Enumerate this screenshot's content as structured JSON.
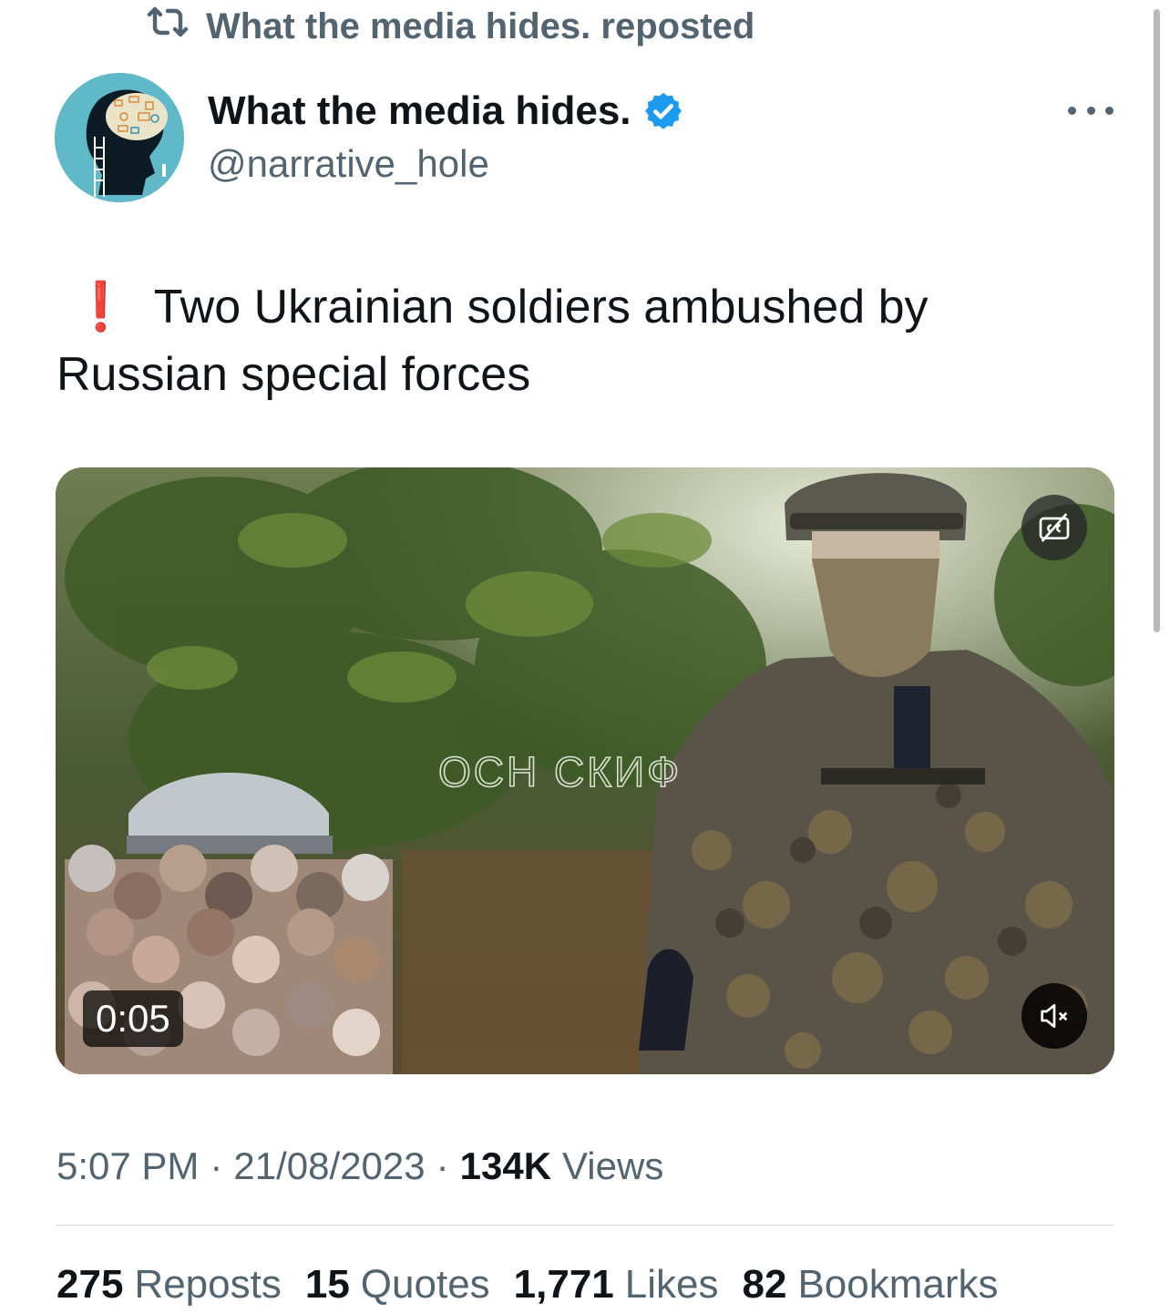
{
  "repost_header": {
    "text": "What the media hides. reposted"
  },
  "author": {
    "display_name": "What the media hides.",
    "handle": "@narrative_hole",
    "verified": true
  },
  "tweet": {
    "emoji": "❗",
    "text": "Two Ukrainian soldiers ambushed by Russian special forces"
  },
  "media": {
    "duration": "0:05",
    "overlay_text": "ОСН СКИФ",
    "cc_icon": "closed-captions-off-icon",
    "mute_icon": "speaker-muted-icon"
  },
  "meta": {
    "time": "5:07 PM",
    "separator": "·",
    "date": "21/08/2023",
    "views_count": "134K",
    "views_label": "Views"
  },
  "stats": {
    "reposts_count": "275",
    "reposts_label": "Reposts",
    "quotes_count": "15",
    "quotes_label": "Quotes",
    "likes_count": "1,771",
    "likes_label": "Likes",
    "bookmarks_count": "82",
    "bookmarks_label": "Bookmarks"
  },
  "colors": {
    "text_primary": "#0f1419",
    "text_secondary": "#536471",
    "verified_blue": "#1d9bf0",
    "alert_red": "#e0202f"
  }
}
